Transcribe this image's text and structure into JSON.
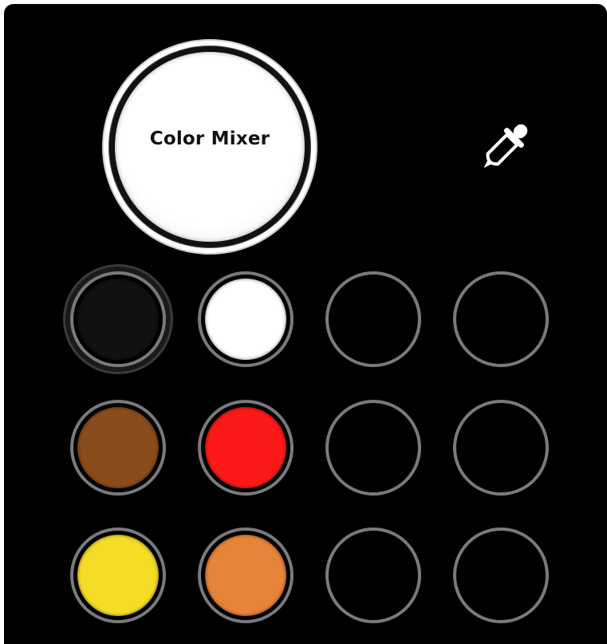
{
  "mixer": {
    "label": "Color Mixer",
    "current_color": "#ffffff"
  },
  "tools": {
    "eyedropper_icon": "eyedropper-icon"
  },
  "palette": [
    {
      "color": "#111111",
      "selected": true
    },
    {
      "color": "#ffffff",
      "selected": false
    },
    {
      "color": null,
      "selected": false
    },
    {
      "color": null,
      "selected": false
    },
    {
      "color": "#8b4c1b",
      "selected": false
    },
    {
      "color": "#fb1a19",
      "selected": false
    },
    {
      "color": null,
      "selected": false
    },
    {
      "color": null,
      "selected": false
    },
    {
      "color": "#f5dc26",
      "selected": false
    },
    {
      "color": "#e8833a",
      "selected": false
    },
    {
      "color": null,
      "selected": false
    },
    {
      "color": null,
      "selected": false
    }
  ]
}
